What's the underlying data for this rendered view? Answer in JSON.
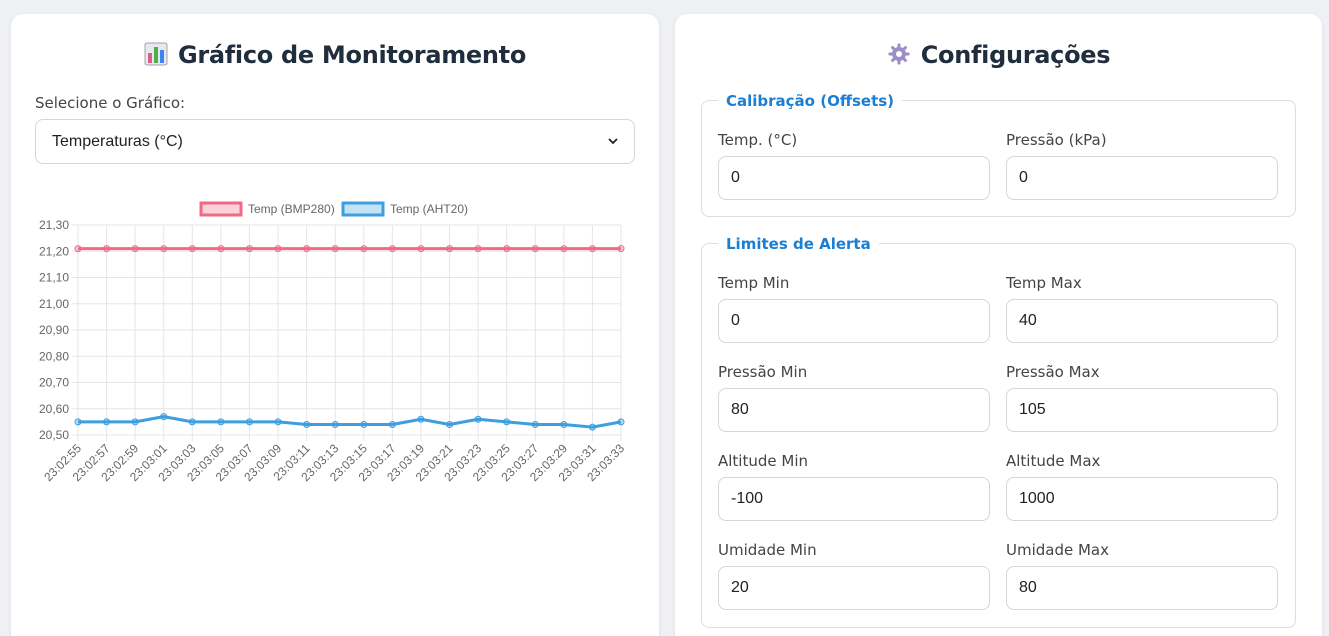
{
  "left": {
    "title": "Gráfico de Monitoramento",
    "select_label": "Selecione o Gráfico:",
    "select_value": "Temperaturas (°C)"
  },
  "right": {
    "title": "Configurações",
    "calibration": {
      "legend": "Calibração (Offsets)",
      "fields": [
        {
          "label": "Temp. (°C)",
          "value": "0"
        },
        {
          "label": "Pressão (kPa)",
          "value": "0"
        }
      ]
    },
    "limits": {
      "legend": "Limites de Alerta",
      "fields": [
        {
          "label": "Temp Min",
          "value": "0"
        },
        {
          "label": "Temp Max",
          "value": "40"
        },
        {
          "label": "Pressão Min",
          "value": "80"
        },
        {
          "label": "Pressão Max",
          "value": "105"
        },
        {
          "label": "Altitude Min",
          "value": "-100"
        },
        {
          "label": "Altitude Max",
          "value": "1000"
        },
        {
          "label": "Umidade Min",
          "value": "20"
        },
        {
          "label": "Umidade Max",
          "value": "80"
        }
      ]
    }
  },
  "colors": {
    "bmp280": "#f06a86",
    "aht20": "#3d9ee0",
    "accent": "#1a7fd4"
  },
  "icons": {
    "chart": "bar-chart-icon",
    "settings": "gear-icon"
  },
  "chart_data": {
    "type": "line",
    "x": [
      "23:02:55",
      "23:02:57",
      "23:02:59",
      "23:03:01",
      "23:03:03",
      "23:03:05",
      "23:03:07",
      "23:03:09",
      "23:03:11",
      "23:03:13",
      "23:03:15",
      "23:03:17",
      "23:03:19",
      "23:03:21",
      "23:03:23",
      "23:03:25",
      "23:03:27",
      "23:03:29",
      "23:03:31",
      "23:03:33"
    ],
    "series": [
      {
        "name": "Temp (BMP280)",
        "values": [
          21.21,
          21.21,
          21.21,
          21.21,
          21.21,
          21.21,
          21.21,
          21.21,
          21.21,
          21.21,
          21.21,
          21.21,
          21.21,
          21.21,
          21.21,
          21.21,
          21.21,
          21.21,
          21.21,
          21.21
        ]
      },
      {
        "name": "Temp (AHT20)",
        "values": [
          20.55,
          20.55,
          20.55,
          20.57,
          20.55,
          20.55,
          20.55,
          20.55,
          20.54,
          20.54,
          20.54,
          20.54,
          20.56,
          20.54,
          20.56,
          20.55,
          20.54,
          20.54,
          20.53,
          20.55
        ]
      }
    ],
    "yticks": [
      "21,30",
      "21,20",
      "21,10",
      "21,00",
      "20,90",
      "20,80",
      "20,70",
      "20,60",
      "20,50"
    ],
    "ylim": [
      20.5,
      21.3
    ],
    "legend_position": "top",
    "grid": true
  }
}
